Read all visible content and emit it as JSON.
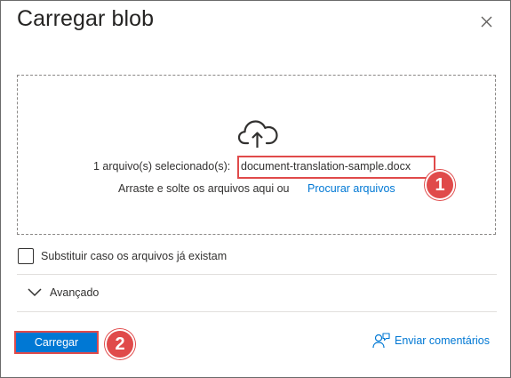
{
  "dialog": {
    "title": "Carregar blob",
    "close_icon": "close-icon"
  },
  "drop_zone": {
    "upload_icon": "cloud-upload-icon",
    "selected_label": "1 arquivo(s) selecionado(s):",
    "selected_file": "document-translation-sample.docx",
    "drag_text": "Arraste e solte os arquivos aqui  ou",
    "browse_link": "Procurar arquivos"
  },
  "options": {
    "overwrite_label": "Substituir caso os arquivos já existam",
    "overwrite_checked": false,
    "advanced_label": "Avançado",
    "advanced_expanded": false
  },
  "footer": {
    "upload_label": "Carregar",
    "feedback_label": "Enviar comentários",
    "feedback_icon": "feedback-person-icon"
  },
  "callouts": {
    "first": "1",
    "second": "2"
  },
  "colors": {
    "accent": "#0078d4",
    "callout": "#e04a4a",
    "text": "#323130",
    "divider": "#e1dfdd"
  }
}
